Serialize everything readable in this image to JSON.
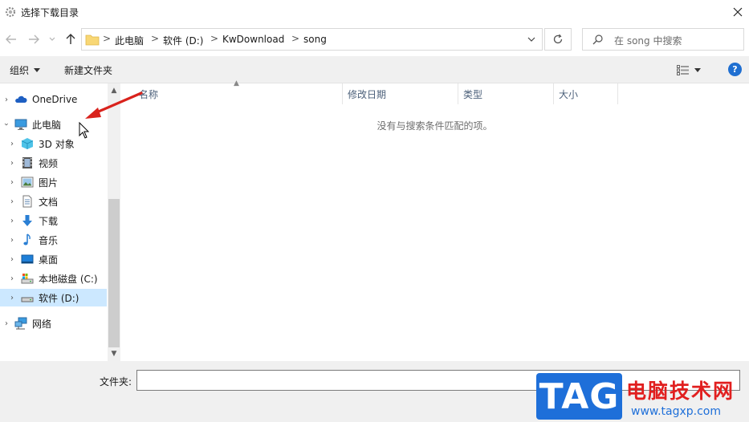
{
  "window": {
    "title": "选择下载目录"
  },
  "address": {
    "crumbs": [
      "此电脑",
      "软件 (D:)",
      "KwDownload",
      "song"
    ],
    "separator": ">"
  },
  "search": {
    "placeholder": "在 song 中搜索"
  },
  "toolbar": {
    "organize_label": "组织",
    "new_folder_label": "新建文件夹",
    "help_label": "?"
  },
  "nav": {
    "items": [
      {
        "label": "OneDrive",
        "icon": "cloud-icon"
      },
      {
        "label": "此电脑",
        "icon": "computer-icon"
      },
      {
        "label": "3D 对象",
        "icon": "cube-3d-icon"
      },
      {
        "label": "视频",
        "icon": "video-icon"
      },
      {
        "label": "图片",
        "icon": "picture-icon"
      },
      {
        "label": "文档",
        "icon": "document-icon"
      },
      {
        "label": "下载",
        "icon": "download-icon"
      },
      {
        "label": "音乐",
        "icon": "music-icon"
      },
      {
        "label": "桌面",
        "icon": "desktop-icon"
      },
      {
        "label": "本地磁盘 (C:)",
        "icon": "drive-c-icon"
      },
      {
        "label": "软件 (D:)",
        "icon": "drive-d-icon"
      },
      {
        "label": "网络",
        "icon": "network-icon"
      }
    ],
    "selected": "软件 (D:)"
  },
  "columns": [
    "名称",
    "修改日期",
    "类型",
    "大小"
  ],
  "content": {
    "empty_message": "没有与搜索条件匹配的项。"
  },
  "bottom": {
    "folder_label": "文件夹:",
    "folder_value": ""
  },
  "watermark": {
    "tag": "TAG",
    "cn": "电脑技术网",
    "url": "www.tagxp.com"
  },
  "colors": {
    "accent": "#1e6fd9",
    "selected_bg": "#cce8ff",
    "watermark_red": "#e11f1f",
    "annotation_arrow": "#d9221c"
  }
}
